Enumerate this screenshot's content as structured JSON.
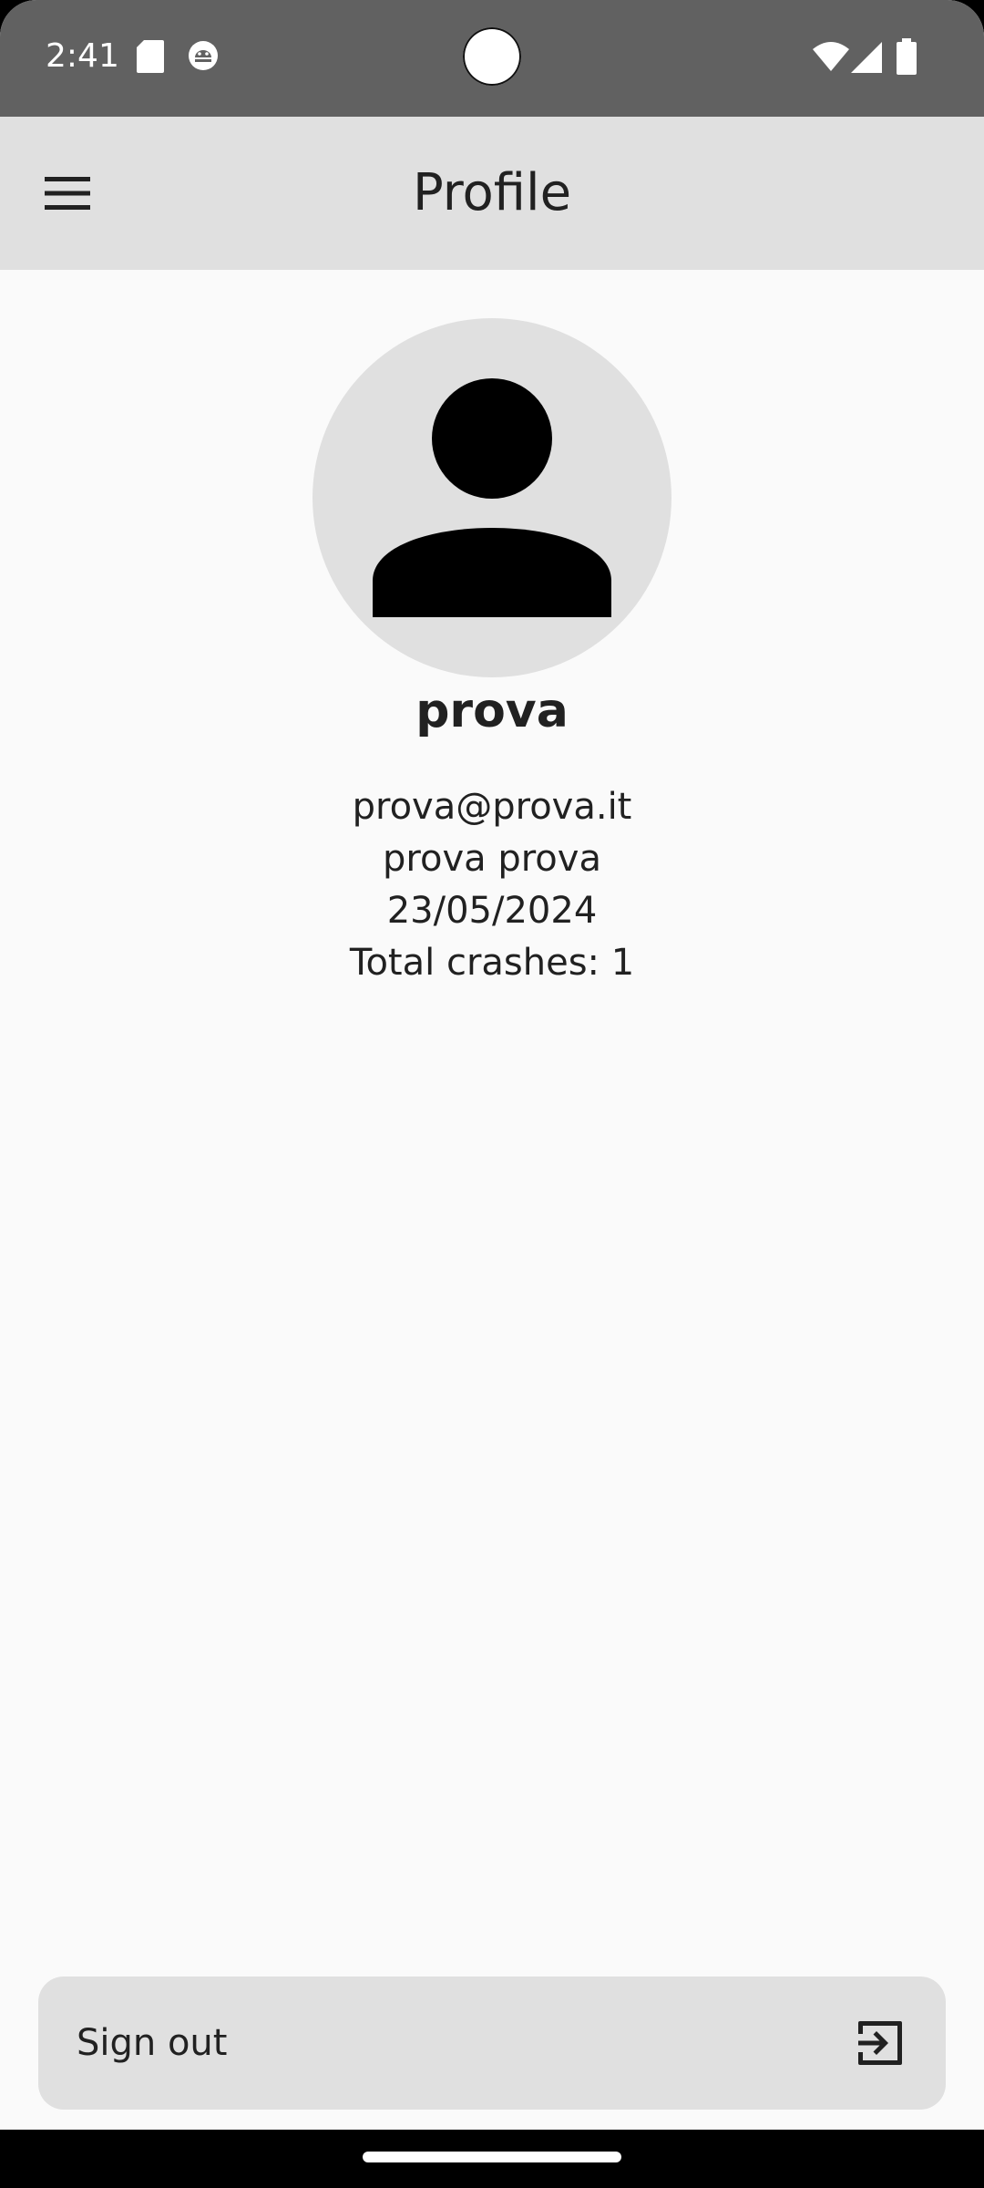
{
  "status_bar": {
    "time": "2:41",
    "left_icons": [
      "sd-card-icon",
      "android-debug-icon"
    ],
    "right_icons": [
      "wifi-icon",
      "cellular-signal-icon",
      "battery-icon"
    ]
  },
  "app_bar": {
    "title": "Profile",
    "menu_icon": "hamburger-menu-icon"
  },
  "profile": {
    "avatar_icon": "person-icon",
    "username": "prova",
    "email": "prova@prova.it",
    "full_name": "prova prova",
    "date": "23/05/2024",
    "total_crashes": "Total crashes: 1"
  },
  "actions": {
    "sign_out_label": "Sign out",
    "sign_out_icon": "logout-icon"
  },
  "colors": {
    "status_bar": "#616161",
    "app_bar": "#e0e0e0",
    "background": "#fafafa",
    "text": "#212121"
  }
}
